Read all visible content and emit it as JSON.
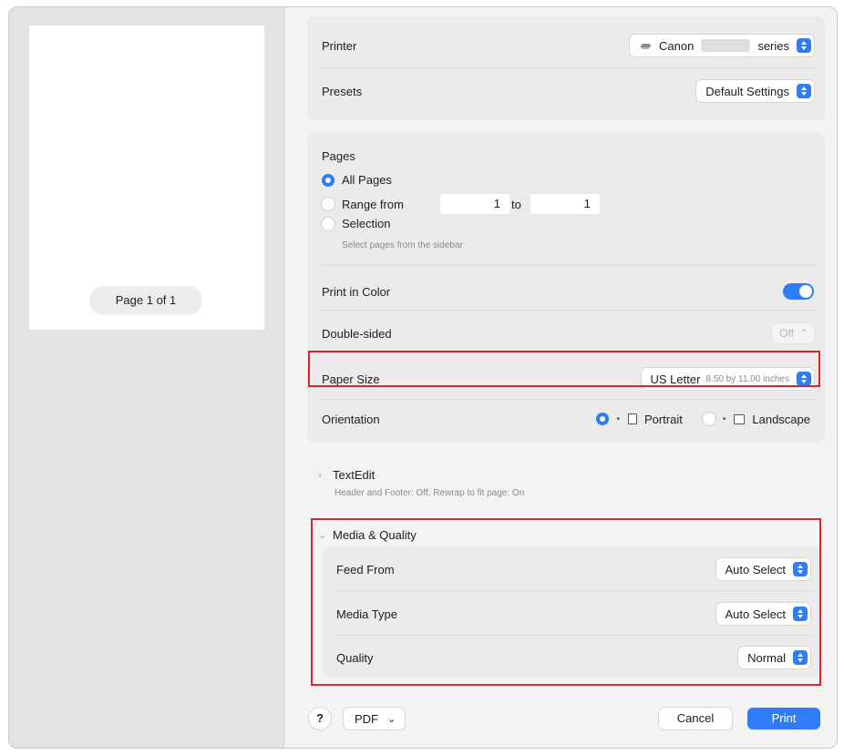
{
  "preview": {
    "page_counter": "Page 1 of 1"
  },
  "printer": {
    "label": "Printer",
    "value_prefix": "Canon",
    "value_suffix": "series"
  },
  "presets": {
    "label": "Presets",
    "value": "Default Settings"
  },
  "pages": {
    "title": "Pages",
    "all_pages": "All Pages",
    "range_from": "Range from",
    "range_start": "1",
    "range_to": "to",
    "range_end": "1",
    "selection": "Selection",
    "selection_hint": "Select pages from the sidebar"
  },
  "print_in_color": {
    "label": "Print in Color",
    "on": true
  },
  "double_sided": {
    "label": "Double-sided",
    "value": "Off"
  },
  "paper_size": {
    "label": "Paper Size",
    "value": "US Letter",
    "detail": "8.50 by 11.00 inches"
  },
  "orientation": {
    "label": "Orientation",
    "portrait": "Portrait",
    "landscape": "Landscape",
    "selected": "Portrait"
  },
  "textedit": {
    "title": "TextEdit",
    "summary": "Header and Footer: Off, Rewrap to fit page: On"
  },
  "media_quality": {
    "title": "Media & Quality",
    "feed_from": {
      "label": "Feed From",
      "value": "Auto Select"
    },
    "media_type": {
      "label": "Media Type",
      "value": "Auto Select"
    },
    "quality": {
      "label": "Quality",
      "value": "Normal"
    }
  },
  "footer": {
    "help": "?",
    "pdf": "PDF",
    "cancel": "Cancel",
    "print": "Print"
  },
  "colors": {
    "accent": "#2f7cf6",
    "highlight": "#d9252b"
  },
  "icons": [
    "printer-icon",
    "popup-stepper-icon",
    "chevron-right-icon",
    "chevron-down-icon",
    "portrait-icon",
    "landscape-icon",
    "pdf-chevron-icon"
  ]
}
